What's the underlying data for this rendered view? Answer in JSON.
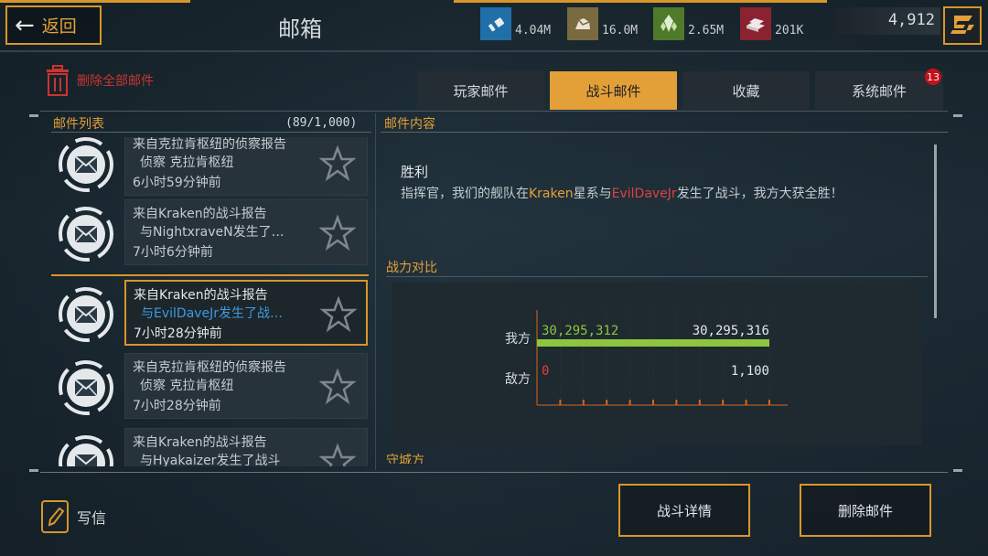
{
  "header": {
    "back_label": "返回",
    "title": "邮箱",
    "resources": [
      {
        "icon": "supply-icon",
        "value": "4.04M",
        "color": "#1f6fa8"
      },
      {
        "icon": "ore-icon",
        "value": "16.0M",
        "color": "#7a6a40"
      },
      {
        "icon": "crystal-icon",
        "value": "2.65M",
        "color": "#4f7a2a"
      },
      {
        "icon": "alloy-icon",
        "value": "201K",
        "color": "#8a2230"
      }
    ],
    "gold": "4,912"
  },
  "toolbar": {
    "delete_all_label": "删除全部邮件"
  },
  "tabs": [
    {
      "label": "玩家邮件",
      "active": false
    },
    {
      "label": "战斗邮件",
      "active": true
    },
    {
      "label": "收藏",
      "active": false
    },
    {
      "label": "系统邮件",
      "active": false
    }
  ],
  "tab_badge": "13",
  "list": {
    "header": "邮件列表",
    "count": "(89/1,000)",
    "mails": [
      {
        "line1": "来自克拉肯枢纽的侦察报告",
        "line2": "侦察 克拉肯枢纽",
        "line3": "6小时59分钟前",
        "selected": false
      },
      {
        "line1": "来自Kraken的战斗报告",
        "line2": "与NightxraveN发生了…",
        "line3": "7小时6分钟前",
        "selected": false
      },
      {
        "line1": "来自Kraken的战斗报告",
        "line2": "与EvilDaveJr发生了战…",
        "line3": "7小时28分钟前",
        "selected": true
      },
      {
        "line1": "来自克拉肯枢纽的侦察报告",
        "line2": "侦察 克拉肯枢纽",
        "line3": "7小时28分钟前",
        "selected": false
      },
      {
        "line1": "来自Kraken的战斗报告",
        "line2": "与Hyakaizer发生了战斗",
        "line3": "",
        "selected": false
      }
    ]
  },
  "content": {
    "header": "邮件内容",
    "title": "胜利",
    "body_prefix": "指挥官，我们的舰队在",
    "body_place": "Kraken",
    "body_mid": "星系与",
    "body_enemy": "EvilDaveJr",
    "body_suffix": "发生了战斗，我方大获全胜！",
    "power_section": "战力对比",
    "next_section": "守城方"
  },
  "chart_data": {
    "type": "bar",
    "title": "",
    "categories": [
      "我方",
      "敌方"
    ],
    "series": [
      {
        "name": "",
        "values": [
          30295312,
          0
        ]
      },
      {
        "name": "",
        "values": [
          30295316,
          1100
        ]
      }
    ],
    "labels": {
      "ours_left": "30,295,312",
      "ours_right": "30,295,316",
      "enemy_left": "0",
      "enemy_right": "1,100"
    },
    "colors": {
      "ours": "#8cc63f",
      "enemy": "#e04040",
      "axis": "#d8661a"
    },
    "xlim": [
      0,
      30295316
    ]
  },
  "footer": {
    "write_label": "写信",
    "battle_detail_label": "战斗详情",
    "delete_mail_label": "删除邮件"
  },
  "colors": {
    "accent": "#d8962a",
    "danger": "#c9352f",
    "link": "#3d9be0"
  }
}
